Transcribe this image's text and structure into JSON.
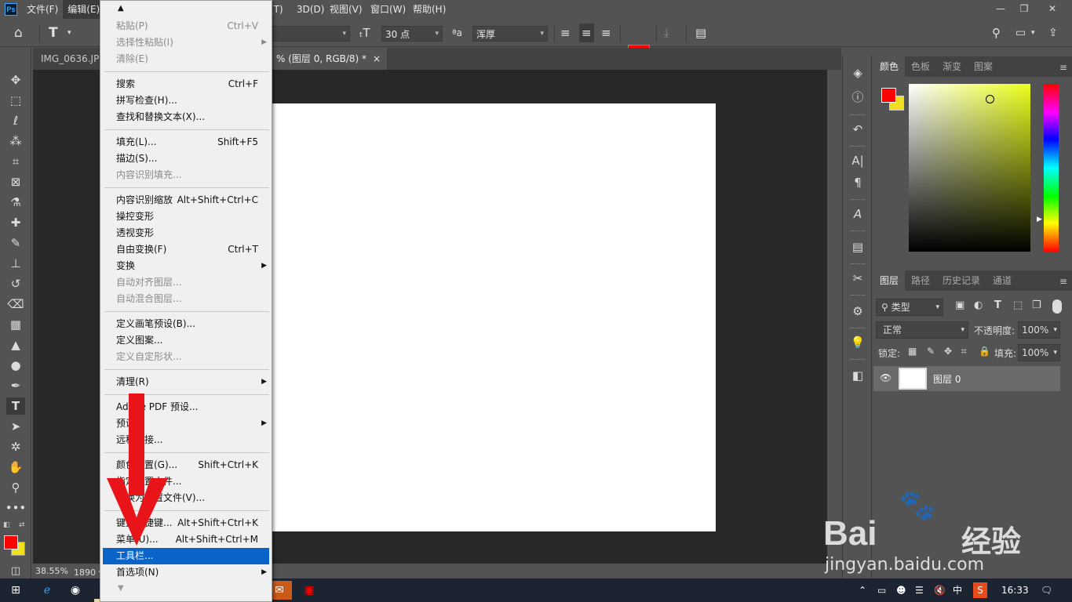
{
  "app": {
    "logo_text": "Ps",
    "menubar": [
      "文件(F)",
      "编辑(E)",
      "(T)",
      "3D(D)",
      "视图(V)",
      "窗口(W)",
      "帮助(H)"
    ],
    "window_controls": [
      "—",
      "❐",
      "✕"
    ]
  },
  "optbar": {
    "size_value": "30 点",
    "aa_label": "ªa",
    "antialias_value": "浑厚",
    "color_swatch": "#ff0000"
  },
  "tabs": {
    "tab1": "IMG_0636.JPG",
    "tab2": "% (图层 0, RGB/8) *",
    "close": "×"
  },
  "status": {
    "zoom": "38.55%",
    "size_info": "1890 像"
  },
  "edit_menu": {
    "items": [
      {
        "label": "粘贴(P)",
        "shortcut": "Ctrl+V",
        "disabled": true
      },
      {
        "label": "选择性粘贴(I)",
        "shortcut": "",
        "disabled": true,
        "submenu": true
      },
      {
        "label": "清除(E)",
        "shortcut": "",
        "disabled": true
      },
      {
        "label": "搜索",
        "shortcut": "Ctrl+F"
      },
      {
        "label": "拼写检查(H)...",
        "shortcut": ""
      },
      {
        "label": "查找和替换文本(X)...",
        "shortcut": ""
      },
      {
        "label": "填充(L)...",
        "shortcut": "Shift+F5"
      },
      {
        "label": "描边(S)...",
        "shortcut": ""
      },
      {
        "label": "内容识别填充...",
        "shortcut": "",
        "disabled": true
      },
      {
        "label": "内容识别缩放",
        "shortcut": "Alt+Shift+Ctrl+C"
      },
      {
        "label": "操控变形",
        "shortcut": ""
      },
      {
        "label": "透视变形",
        "shortcut": ""
      },
      {
        "label": "自由变换(F)",
        "shortcut": "Ctrl+T"
      },
      {
        "label": "变换",
        "shortcut": "",
        "submenu": true
      },
      {
        "label": "自动对齐图层...",
        "shortcut": "",
        "disabled": true
      },
      {
        "label": "自动混合图层...",
        "shortcut": "",
        "disabled": true
      },
      {
        "label": "定义画笔预设(B)...",
        "shortcut": ""
      },
      {
        "label": "定义图案...",
        "shortcut": ""
      },
      {
        "label": "定义自定形状...",
        "shortcut": "",
        "disabled": true
      },
      {
        "label": "清理(R)",
        "shortcut": "",
        "submenu": true
      },
      {
        "label": "Adobe PDF 预设...",
        "shortcut": ""
      },
      {
        "label": "预设",
        "shortcut": "",
        "submenu": true
      },
      {
        "label": "远程连接...",
        "shortcut": ""
      },
      {
        "label": "颜色设置(G)...",
        "shortcut": "Shift+Ctrl+K"
      },
      {
        "label": "指定配置文件...",
        "shortcut": ""
      },
      {
        "label": "转换为配置文件(V)...",
        "shortcut": ""
      },
      {
        "label": "键盘快捷键...",
        "shortcut": "Alt+Shift+Ctrl+K"
      },
      {
        "label": "菜单(U)...",
        "shortcut": "Alt+Shift+Ctrl+M"
      },
      {
        "label": "工具栏...",
        "shortcut": "",
        "highlighted": true
      },
      {
        "label": "首选项(N)",
        "shortcut": "",
        "submenu": true
      }
    ]
  },
  "color_panel": {
    "tabs": [
      "颜色",
      "色板",
      "渐变",
      "图案"
    ],
    "fg": "#ff0000",
    "bg": "#f0e020"
  },
  "layers_panel": {
    "tabs": [
      "图层",
      "路径",
      "历史记录",
      "通道"
    ],
    "filter_label": "类型",
    "blend_mode": "正常",
    "opacity_label": "不透明度:",
    "opacity_value": "100%",
    "lock_label": "锁定:",
    "fill_label": "填充:",
    "fill_value": "100%",
    "layer_name": "图层 0"
  },
  "taskbar": {
    "time": "16:33",
    "ime": "中"
  },
  "watermark": {
    "brand": "Bai",
    "brand2": "经验",
    "url": "jingyan.baidu.com"
  }
}
